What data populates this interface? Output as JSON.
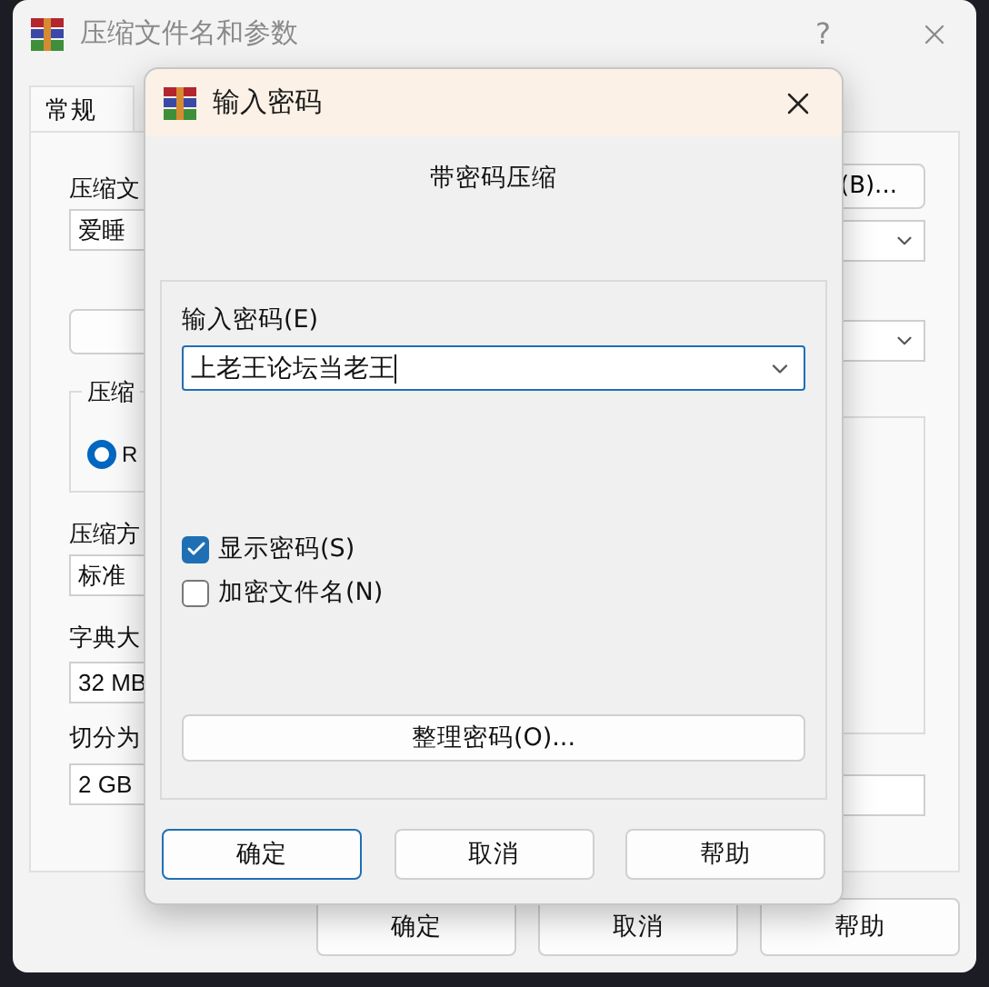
{
  "background_window": {
    "title": "压缩文件名和参数",
    "help": "?",
    "tabs": [
      {
        "label": "常规",
        "selected": true
      }
    ],
    "left_column": [
      {
        "kind": "label",
        "text": "压缩文"
      },
      {
        "kind": "field",
        "text": "爱睡"
      },
      {
        "kind": "blank_button"
      },
      {
        "kind": "group",
        "label": "压缩",
        "option": "R",
        "selected": true
      },
      {
        "kind": "label",
        "text": "压缩方"
      },
      {
        "kind": "field",
        "text": "标准"
      },
      {
        "kind": "label",
        "text": "字典大"
      },
      {
        "kind": "field",
        "text": "32 MB"
      },
      {
        "kind": "label",
        "text": "切分为"
      },
      {
        "kind": "field",
        "text": "2 GB"
      }
    ],
    "right_column": [
      {
        "kind": "button",
        "text": "(B)..."
      },
      {
        "kind": "combo"
      },
      {
        "kind": "combo"
      },
      {
        "kind": "group"
      },
      {
        "kind": "field"
      }
    ],
    "buttons": [
      "确定",
      "取消",
      "帮助"
    ]
  },
  "dialog": {
    "title": "输入密码",
    "heading": "带密码压缩",
    "password_label": "输入密码(E)",
    "password_value": "上老王论坛当老王",
    "options": [
      {
        "label": "显示密码(S)",
        "checked": true
      },
      {
        "label": "加密文件名(N)",
        "checked": false
      }
    ],
    "organize_button": "整理密码(O)...",
    "buttons": [
      {
        "label": "确定",
        "default": true
      },
      {
        "label": "取消",
        "default": false
      },
      {
        "label": "帮助",
        "default": false
      }
    ]
  }
}
